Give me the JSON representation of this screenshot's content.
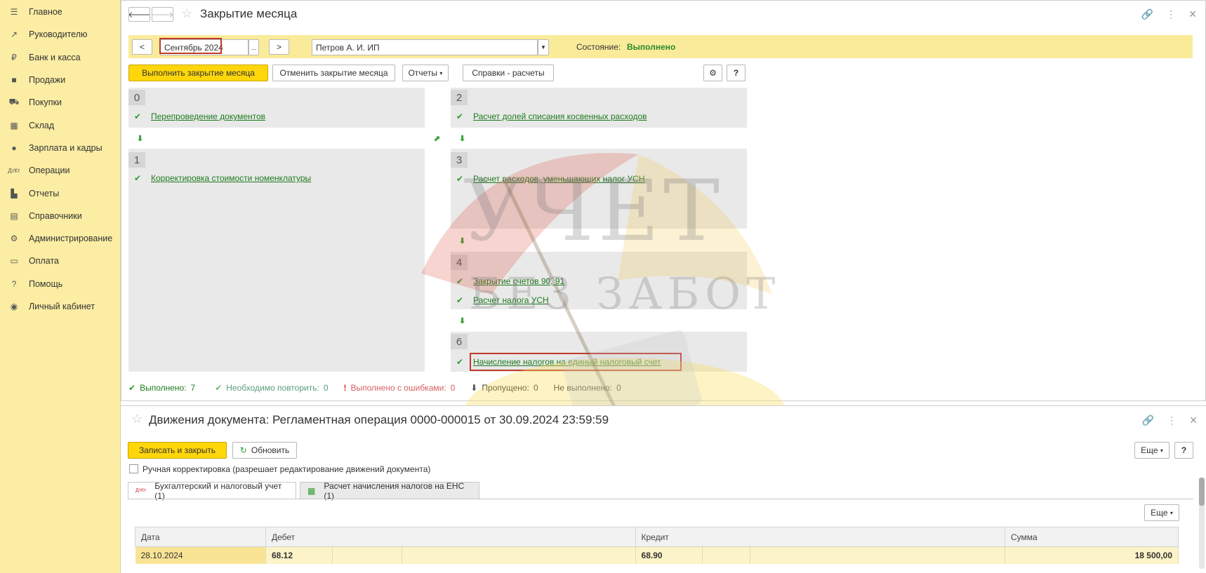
{
  "sidebar": {
    "items": [
      {
        "label": "Главное",
        "icon": "menu-icon"
      },
      {
        "label": "Руководителю",
        "icon": "trend-icon"
      },
      {
        "label": "Банк и касса",
        "icon": "ruble-icon"
      },
      {
        "label": "Продажи",
        "icon": "bag-icon"
      },
      {
        "label": "Покупки",
        "icon": "cart-icon"
      },
      {
        "label": "Склад",
        "icon": "warehouse-icon"
      },
      {
        "label": "Зарплата и кадры",
        "icon": "person-icon"
      },
      {
        "label": "Операции",
        "icon": "dt-kt-icon"
      },
      {
        "label": "Отчеты",
        "icon": "chart-icon"
      },
      {
        "label": "Справочники",
        "icon": "book-icon"
      },
      {
        "label": "Администрирование",
        "icon": "gear-icon"
      },
      {
        "label": "Оплата",
        "icon": "payment-icon"
      },
      {
        "label": "Помощь",
        "icon": "question-icon"
      },
      {
        "label": "Личный кабинет",
        "icon": "user-circle-icon"
      }
    ]
  },
  "main": {
    "title": "Закрытие месяца",
    "period_prev": "<",
    "period_value": "Сентябрь 2024",
    "period_dots": "...",
    "period_next": ">",
    "organization": "Петров А. И. ИП",
    "state_label": "Состояние:",
    "state_value": "Выполнено",
    "btn_execute": "Выполнить закрытие месяца",
    "btn_cancel": "Отменить закрытие месяца",
    "btn_reports": "Отчеты",
    "btn_refs": "Справки - расчеты",
    "help": "?",
    "steps": {
      "s0": {
        "num": "0",
        "tasks": [
          "Перепроведение документов"
        ]
      },
      "s1": {
        "num": "1",
        "tasks": [
          "Корректировка стоимости номенклатуры"
        ]
      },
      "s2": {
        "num": "2",
        "tasks": [
          "Расчет долей списания косвенных расходов"
        ]
      },
      "s3": {
        "num": "3",
        "tasks": [
          "Расчет расходов, уменьшающих налог УСН"
        ]
      },
      "s4": {
        "num": "4",
        "tasks": [
          "Закрытие счетов 90, 91",
          "Расчет налога УСН"
        ]
      },
      "s6": {
        "num": "6",
        "tasks": [
          "Начисление налогов на единый налоговый счет"
        ]
      }
    },
    "status": {
      "done_label": "Выполнено:",
      "done_count": "7",
      "repeat_label": "Необходимо повторить:",
      "repeat_count": "0",
      "errors_label": "Выполнено с ошибками:",
      "errors_count": "0",
      "skipped_label": "Пропущено:",
      "skipped_count": "0",
      "notdone_label": "Не выполнено:",
      "notdone_count": "0"
    }
  },
  "bottom": {
    "title": "Движения документа: Регламентная операция 0000-000015 от 30.09.2024 23:59:59",
    "btn_save": "Записать и закрыть",
    "btn_refresh": "Обновить",
    "btn_more": "Еще",
    "help": "?",
    "manual_label": "Ручная корректировка (разрешает редактирование движений документа)",
    "tabs": [
      "Бухгалтерский и налоговый учет (1)",
      "Расчет начисления налогов на ЕНС (1)"
    ],
    "table": {
      "headers": [
        "Дата",
        "Дебет",
        "Кредит",
        "Сумма"
      ],
      "rows": [
        {
          "date": "28.10.2024",
          "debit": "68.12",
          "credit": "68.90",
          "sum": "18 500,00"
        }
      ]
    }
  },
  "watermark": {
    "line1": "УЧЕТ",
    "line2": "БЕЗ ЗАБОТ"
  }
}
